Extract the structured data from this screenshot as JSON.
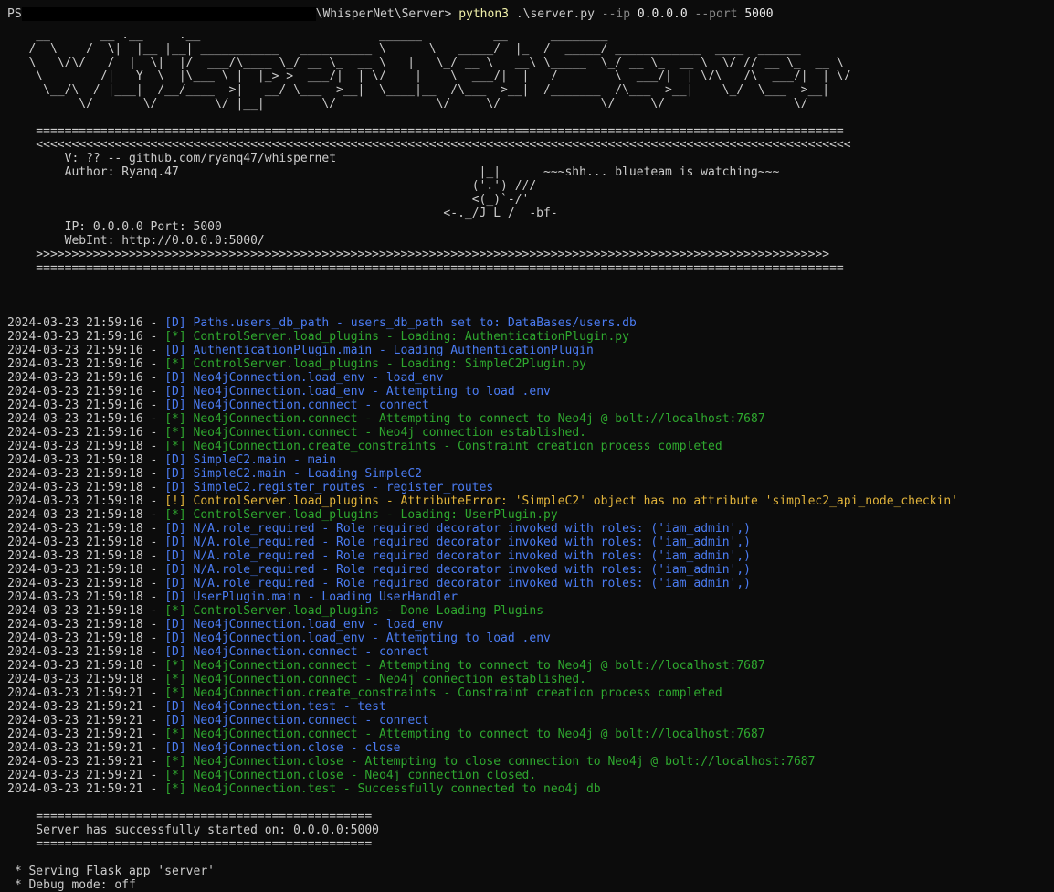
{
  "prompt": {
    "ps": "PS",
    "path_tail": "\\WhisperNet\\Server>",
    "command": "python3",
    "script": ".\\server.py",
    "flag_ip": "--ip",
    "ip_value": "0.0.0.0",
    "flag_port": "--port",
    "port_value": "5000"
  },
  "banner": {
    "art": [
      "    __       __ .__     .__                         ______          __      ________",
      "   /  \\    /  \\|  |__ |__| ___________   __________ \\      \\   _____/  |_  /  _____/ ____________  ____  ______",
      "   \\   \\/\\/   /  |  \\|  |/  ___/\\____ \\_/ __ \\_  __ \\   |   \\_/ __ \\   __\\ \\_____  \\_/ __ \\_  __ \\  \\/ // __ \\_  __ \\",
      "    \\        /|   Y  \\  |\\___ \\ |  |_> >  ___/|  | \\/    |    \\  ___/|  |   /        \\  ___/|  | \\/\\   /\\  ___/|  | \\/",
      "     \\__/\\  / |___|  /__/____  >|   __/ \\___  >__|  \\____|__  /\\___  >__|  /_______  /\\___  >__|    \\_/  \\___  >__|",
      "          \\/       \\/        \\/ |__|        \\/              \\/     \\/              \\/     \\/                  \\/"
    ],
    "rule_eq": "    =================================================================================================================",
    "rule_lt": "    <<<<<<<<<<<<<<<<<<<<<<<<<<<<<<<<<<<<<<<<<<<<<<<<<<<<<<<<<<<<<<<<<<<<<<<<<<<<<<<<<<<<<<<<<<<<<<<<<<<<<<<<<<<<<<<<<<",
    "rule_gt": "    >>>>>>>>>>>>>>>>>>>>>>>>>>>>>>>>>>>>>>>>>>>>>>>>>>>>>>>>>>>>>>>>>>>>>>>>>>>>>>>>>>>>>>>>>>>>>>>>>>>>>>>>>>>>>>>",
    "info": [
      "        V: ?? -- github.com/ryanq47/whispernet",
      "        Author: Ryanq.47                                          |_|      ~~~shh... blueteam is watching~~~",
      "                                                                 ('.') ///",
      "                                                                 <(_)`-/'",
      "                                                             <-._/J L /  -bf-",
      "        IP: 0.0.0.0 Port: 5000",
      "        WebInt: http://0.0.0.0:5000/"
    ]
  },
  "log": [
    {
      "ts": "2024-03-23 21:59:16",
      "tag": "[D]",
      "msg": "Paths.users_db_path - users_db_path set to: DataBases/users.db",
      "level": "d"
    },
    {
      "ts": "2024-03-23 21:59:16",
      "tag": "[*]",
      "msg": "ControlServer.load_plugins - Loading: AuthenticationPlugin.py",
      "level": "s"
    },
    {
      "ts": "2024-03-23 21:59:16",
      "tag": "[D]",
      "msg": "AuthenticationPlugin.main - Loading AuthenticationPlugin",
      "level": "d"
    },
    {
      "ts": "2024-03-23 21:59:16",
      "tag": "[*]",
      "msg": "ControlServer.load_plugins - Loading: SimpleC2Plugin.py",
      "level": "s"
    },
    {
      "ts": "2024-03-23 21:59:16",
      "tag": "[D]",
      "msg": "Neo4jConnection.load_env - load_env",
      "level": "d"
    },
    {
      "ts": "2024-03-23 21:59:16",
      "tag": "[D]",
      "msg": "Neo4jConnection.load_env - Attempting to load .env",
      "level": "d"
    },
    {
      "ts": "2024-03-23 21:59:16",
      "tag": "[D]",
      "msg": "Neo4jConnection.connect - connect",
      "level": "d"
    },
    {
      "ts": "2024-03-23 21:59:16",
      "tag": "[*]",
      "msg": "Neo4jConnection.connect - Attempting to connect to Neo4j @ bolt://localhost:7687",
      "level": "s"
    },
    {
      "ts": "2024-03-23 21:59:16",
      "tag": "[*]",
      "msg": "Neo4jConnection.connect - Neo4j connection established.",
      "level": "s"
    },
    {
      "ts": "2024-03-23 21:59:18",
      "tag": "[*]",
      "msg": "Neo4jConnection.create_constraints - Constraint creation process completed",
      "level": "s"
    },
    {
      "ts": "2024-03-23 21:59:18",
      "tag": "[D]",
      "msg": "SimpleC2.main - main",
      "level": "d"
    },
    {
      "ts": "2024-03-23 21:59:18",
      "tag": "[D]",
      "msg": "SimpleC2.main - Loading SimpleC2",
      "level": "d"
    },
    {
      "ts": "2024-03-23 21:59:18",
      "tag": "[D]",
      "msg": "SimpleC2.register_routes - register_routes",
      "level": "d"
    },
    {
      "ts": "2024-03-23 21:59:18",
      "tag": "[!]",
      "msg": "ControlServer.load_plugins - AttributeError: 'SimpleC2' object has no attribute 'simplec2_api_node_checkin'",
      "level": "w"
    },
    {
      "ts": "2024-03-23 21:59:18",
      "tag": "[*]",
      "msg": "ControlServer.load_plugins - Loading: UserPlugin.py",
      "level": "s"
    },
    {
      "ts": "2024-03-23 21:59:18",
      "tag": "[D]",
      "msg": "N/A.role_required - Role required decorator invoked with roles: ('iam_admin',)",
      "level": "d"
    },
    {
      "ts": "2024-03-23 21:59:18",
      "tag": "[D]",
      "msg": "N/A.role_required - Role required decorator invoked with roles: ('iam_admin',)",
      "level": "d"
    },
    {
      "ts": "2024-03-23 21:59:18",
      "tag": "[D]",
      "msg": "N/A.role_required - Role required decorator invoked with roles: ('iam_admin',)",
      "level": "d"
    },
    {
      "ts": "2024-03-23 21:59:18",
      "tag": "[D]",
      "msg": "N/A.role_required - Role required decorator invoked with roles: ('iam_admin',)",
      "level": "d"
    },
    {
      "ts": "2024-03-23 21:59:18",
      "tag": "[D]",
      "msg": "N/A.role_required - Role required decorator invoked with roles: ('iam_admin',)",
      "level": "d"
    },
    {
      "ts": "2024-03-23 21:59:18",
      "tag": "[D]",
      "msg": "UserPlugin.main - Loading UserHandler",
      "level": "d"
    },
    {
      "ts": "2024-03-23 21:59:18",
      "tag": "[*]",
      "msg": "ControlServer.load_plugins - Done Loading Plugins",
      "level": "s"
    },
    {
      "ts": "2024-03-23 21:59:18",
      "tag": "[D]",
      "msg": "Neo4jConnection.load_env - load_env",
      "level": "d"
    },
    {
      "ts": "2024-03-23 21:59:18",
      "tag": "[D]",
      "msg": "Neo4jConnection.load_env - Attempting to load .env",
      "level": "d"
    },
    {
      "ts": "2024-03-23 21:59:18",
      "tag": "[D]",
      "msg": "Neo4jConnection.connect - connect",
      "level": "d"
    },
    {
      "ts": "2024-03-23 21:59:18",
      "tag": "[*]",
      "msg": "Neo4jConnection.connect - Attempting to connect to Neo4j @ bolt://localhost:7687",
      "level": "s"
    },
    {
      "ts": "2024-03-23 21:59:18",
      "tag": "[*]",
      "msg": "Neo4jConnection.connect - Neo4j connection established.",
      "level": "s"
    },
    {
      "ts": "2024-03-23 21:59:21",
      "tag": "[*]",
      "msg": "Neo4jConnection.create_constraints - Constraint creation process completed",
      "level": "s"
    },
    {
      "ts": "2024-03-23 21:59:21",
      "tag": "[D]",
      "msg": "Neo4jConnection.test - test",
      "level": "d"
    },
    {
      "ts": "2024-03-23 21:59:21",
      "tag": "[D]",
      "msg": "Neo4jConnection.connect - connect",
      "level": "d"
    },
    {
      "ts": "2024-03-23 21:59:21",
      "tag": "[*]",
      "msg": "Neo4jConnection.connect - Attempting to connect to Neo4j @ bolt://localhost:7687",
      "level": "s"
    },
    {
      "ts": "2024-03-23 21:59:21",
      "tag": "[D]",
      "msg": "Neo4jConnection.close - close",
      "level": "d"
    },
    {
      "ts": "2024-03-23 21:59:21",
      "tag": "[*]",
      "msg": "Neo4jConnection.close - Attempting to close connection to Neo4j @ bolt://localhost:7687",
      "level": "s"
    },
    {
      "ts": "2024-03-23 21:59:21",
      "tag": "[*]",
      "msg": "Neo4jConnection.close - Neo4j connection closed.",
      "level": "s"
    },
    {
      "ts": "2024-03-23 21:59:21",
      "tag": "[*]",
      "msg": "Neo4jConnection.test - Successfully connected to neo4j db",
      "level": "s"
    }
  ],
  "startup": {
    "rule": "    ===============================================",
    "message": "    Server has successfully started on: 0.0.0.0:5000"
  },
  "flask": {
    "serving": " * Serving Flask app 'server'",
    "debug": " * Debug mode: off"
  },
  "colors": {
    "background": "#0c0c0c",
    "foreground": "#cccccc",
    "debug": "#4b7cf3",
    "info": "#2fa82f",
    "warning": "#e2b43b"
  }
}
